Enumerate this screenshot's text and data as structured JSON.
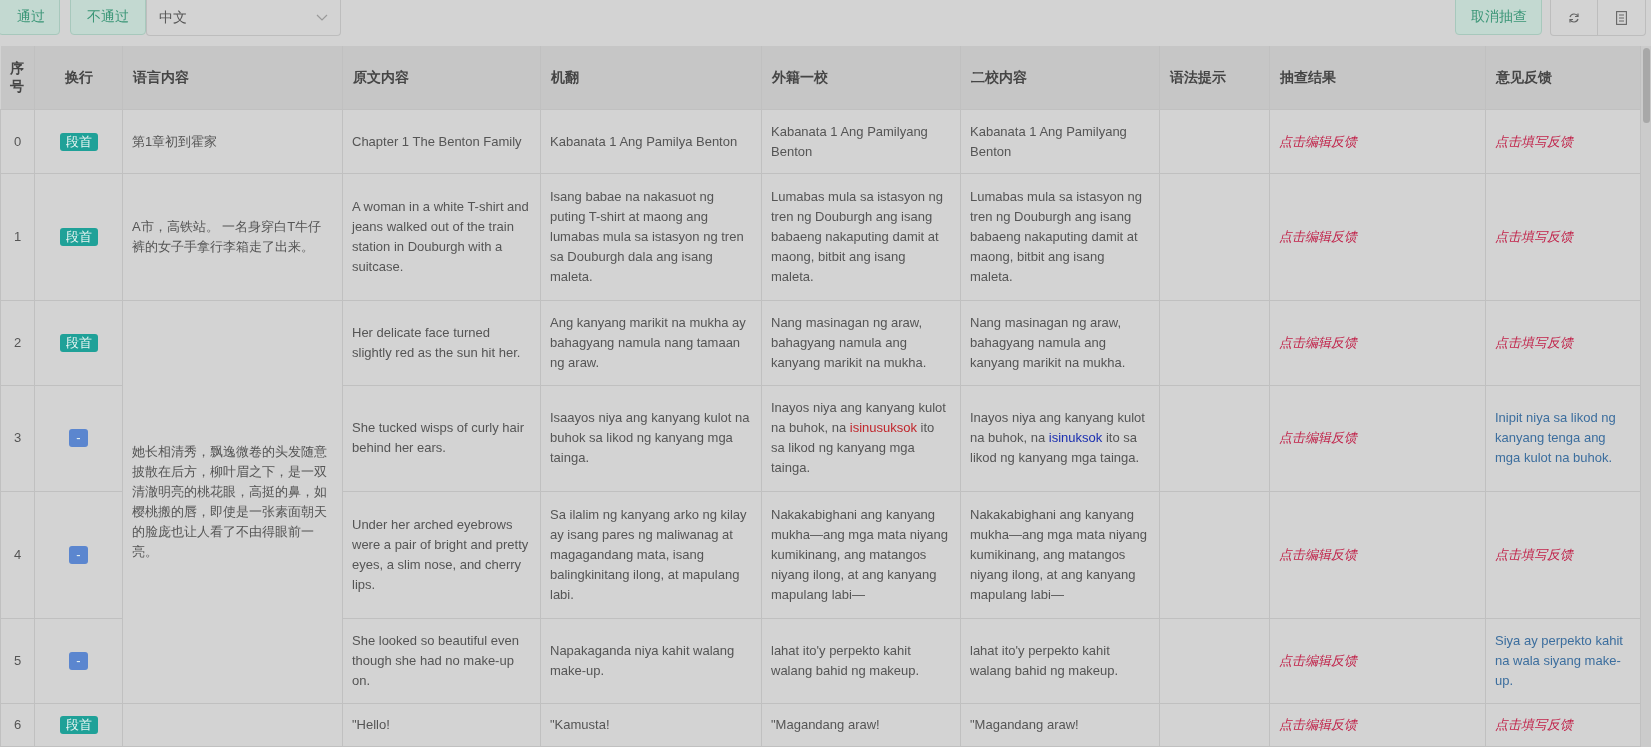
{
  "toolbar": {
    "buttons": [
      {
        "label": "通过"
      },
      {
        "label": "不通过"
      }
    ],
    "language_select": {
      "value": "中文"
    },
    "cancel_button": {
      "label": "取消抽查"
    }
  },
  "table": {
    "columns": [
      "序号",
      "换行",
      "语言内容",
      "原文内容",
      "机翻",
      "外籍一校",
      "二校内容",
      "语法提示",
      "抽查结果",
      "意见反馈"
    ],
    "rows": [
      {
        "index": "0",
        "tag": {
          "label": "段首",
          "kind": "paragraph"
        },
        "language": "第1章初到霍家",
        "source": "Chapter 1 The Benton Family",
        "machine": "Kabanata 1 Ang Pamilya Benton",
        "first_review": "Kabanata 1 Ang Pamilyang Benton",
        "second_review": "Kabanata 1 Ang Pamilyang Benton",
        "result": {
          "text": "点击编辑反馈",
          "kind": "prompt"
        },
        "feedback": {
          "text": "点击填写反馈",
          "kind": "prompt"
        }
      },
      {
        "index": "1",
        "tag": {
          "label": "段首",
          "kind": "paragraph"
        },
        "language": "A市，高铁站。 一名身穿白T牛仔裤的女子手拿行李箱走了出来。",
        "source": "A woman in a white T-shirt and jeans walked out of the train station in Douburgh with a suitcase.",
        "machine": "Isang babae na nakasuot ng puting T-shirt at maong ang lumabas mula sa istasyon ng tren sa Douburgh dala ang isang maleta.",
        "first_review": "Lumabas mula sa istasyon ng tren ng Douburgh ang isang babaeng nakaputing damit at maong, bitbit ang isang maleta.",
        "second_review": "Lumabas mula sa istasyon ng tren ng Douburgh ang isang babaeng nakaputing damit at maong, bitbit ang isang maleta.",
        "result": {
          "text": "点击编辑反馈",
          "kind": "prompt"
        },
        "feedback": {
          "text": "点击填写反馈",
          "kind": "prompt"
        }
      },
      {
        "index": "2",
        "tag": {
          "label": "段首",
          "kind": "paragraph"
        },
        "language": "她长相清秀，飘逸微卷的头发随意披散在后方，柳叶眉之下，是一双清澈明亮的桃花眼，高挺的鼻，如樱桃搬的唇，即使是一张素面朝天的脸庞也让人看了不由得眼前一亮。",
        "source": "Her delicate face turned slightly red as the sun hit her.",
        "machine": "Ang kanyang marikit na mukha ay bahagyang namula nang tamaan ng araw.",
        "first_review": "Nang masinagan ng araw, bahagyang namula ang kanyang marikit na mukha.",
        "second_review": "Nang masinagan ng araw, bahagyang namula ang kanyang marikit na mukha.",
        "result": {
          "text": "点击编辑反馈",
          "kind": "prompt"
        },
        "feedback": {
          "text": "点击填写反馈",
          "kind": "prompt"
        }
      },
      {
        "index": "3",
        "tag": {
          "label": "-",
          "kind": "continuation"
        },
        "language_merged": true,
        "source": "She tucked wisps of curly hair behind her ears.",
        "machine": "Isaayos niya ang kanyang kulot na buhok sa likod ng kanyang mga tainga.",
        "first_review": {
          "segments": [
            {
              "text": "Inayos niya ang kanyang kulot na buhok, na "
            },
            {
              "text": "isinusuksok",
              "kind": "error"
            },
            {
              "text": " ito sa likod ng kanyang mga tainga."
            }
          ]
        },
        "second_review": {
          "segments": [
            {
              "text": "Inayos niya ang kanyang kulot na buhok, na "
            },
            {
              "text": "isinuksok",
              "kind": "fix"
            },
            {
              "text": " ito sa likod ng kanyang mga tainga."
            }
          ]
        },
        "result": {
          "text": "点击编辑反馈",
          "kind": "prompt"
        },
        "feedback": {
          "text": "Inipit niya sa likod ng kanyang tenga ang mga kulot na buhok.",
          "kind": "note"
        }
      },
      {
        "index": "4",
        "tag": {
          "label": "-",
          "kind": "continuation"
        },
        "language_merged": true,
        "source": "Under her arched eyebrows were a pair of bright and pretty eyes, a slim nose, and cherry lips.",
        "machine": "Sa ilalim ng kanyang arko ng kilay ay isang pares ng maliwanag at magagandang mata, isang balingkinitang ilong, at mapulang labi.",
        "first_review": "Nakakabighani ang kanyang mukha—ang mga mata niyang kumikinang, ang matangos niyang ilong, at ang kanyang mapulang labi—",
        "second_review": "Nakakabighani ang kanyang mukha—ang mga mata niyang kumikinang, ang matangos niyang ilong, at ang kanyang mapulang labi—",
        "result": {
          "text": "点击编辑反馈",
          "kind": "prompt"
        },
        "feedback": {
          "text": "点击填写反馈",
          "kind": "prompt"
        }
      },
      {
        "index": "5",
        "tag": {
          "label": "-",
          "kind": "continuation"
        },
        "language_merged": true,
        "source": "She looked so beautiful even though she had no make-up on.",
        "machine": "Napakaganda niya kahit walang make-up.",
        "first_review": "lahat ito'y perpekto kahit walang bahid ng makeup.",
        "second_review": "lahat ito'y perpekto kahit walang bahid ng makeup.",
        "result": {
          "text": "点击编辑反馈",
          "kind": "prompt"
        },
        "feedback": {
          "text": "Siya ay perpekto kahit na wala siyang make-up.",
          "kind": "note"
        }
      },
      {
        "index": "6",
        "tag": {
          "label": "段首",
          "kind": "paragraph"
        },
        "source": "\"Hello!",
        "machine": "\"Kamusta!",
        "first_review": "\"Magandang araw!",
        "second_review": "\"Magandang araw!",
        "result": {
          "text": "点击编辑反馈",
          "kind": "prompt"
        },
        "feedback": {
          "text": "点击填写反馈",
          "kind": "prompt"
        }
      }
    ]
  }
}
